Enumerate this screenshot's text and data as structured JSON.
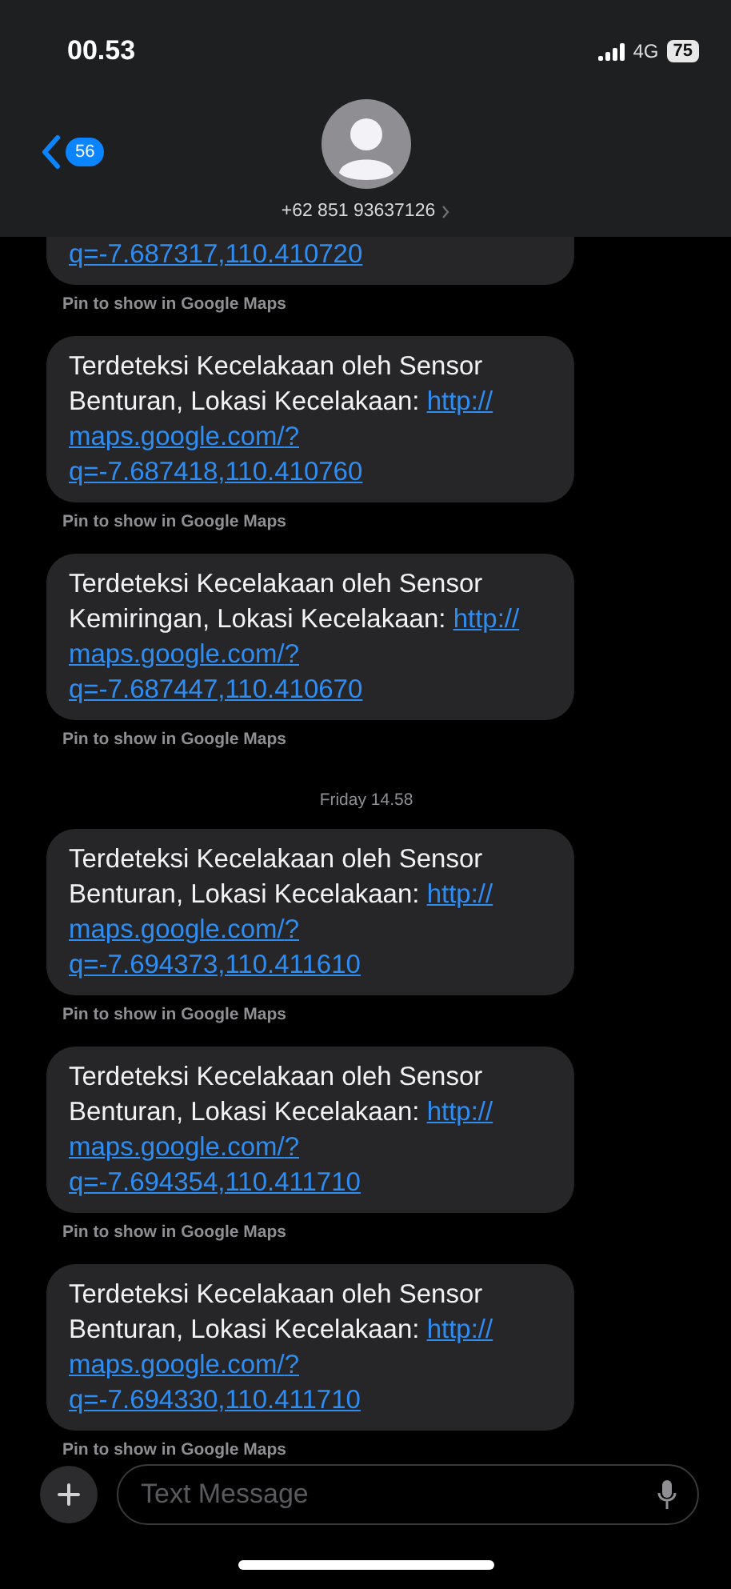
{
  "status_bar": {
    "time": "00.53",
    "network": "4G",
    "battery": "75"
  },
  "header": {
    "unread_count": "56",
    "contact": "+62 851 93637126"
  },
  "thread": [
    {
      "kind": "cut_message",
      "link": "q=-7.687317,110.410720",
      "note": "Pin to show in Google Maps"
    },
    {
      "kind": "message",
      "text": "Terdeteksi Kecelakaan oleh Sensor Benturan, Lokasi Kecelakaan:",
      "link": "http://maps.google.com/?q=-7.687418,110.410760",
      "note": "Pin to show in Google Maps"
    },
    {
      "kind": "message",
      "text": "Terdeteksi Kecelakaan oleh Sensor Kemiringan, Lokasi Kecelakaan:",
      "link": "http://maps.google.com/?q=-7.687447,110.410670",
      "note": "Pin to show in Google Maps"
    },
    {
      "kind": "timestamp",
      "text": "Friday 14.58"
    },
    {
      "kind": "message",
      "text": "Terdeteksi Kecelakaan oleh Sensor Benturan, Lokasi Kecelakaan:",
      "link": "http://maps.google.com/?q=-7.694373,110.411610",
      "note": "Pin to show in Google Maps"
    },
    {
      "kind": "message",
      "text": "Terdeteksi Kecelakaan oleh Sensor Benturan, Lokasi Kecelakaan:",
      "link": "http://maps.google.com/?q=-7.694354,110.411710",
      "note": "Pin to show in Google Maps"
    },
    {
      "kind": "message",
      "text": "Terdeteksi Kecelakaan oleh Sensor Benturan, Lokasi Kecelakaan:",
      "link": "http://maps.google.com/?q=-7.694330,110.411710",
      "note": "Pin to show in Google Maps"
    }
  ],
  "composer": {
    "placeholder": "Text Message"
  }
}
